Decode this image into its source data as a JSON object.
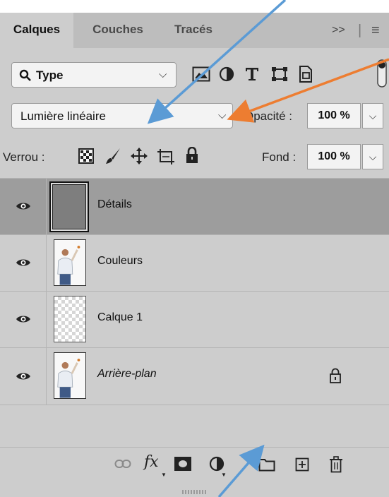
{
  "tabs": [
    {
      "label": "Calques",
      "active": true
    },
    {
      "label": "Couches",
      "active": false
    },
    {
      "label": "Tracés",
      "active": false
    }
  ],
  "tab_menu": {
    "collapse": ">>",
    "separator": "|",
    "menu": "≡"
  },
  "filter": {
    "label": "Type",
    "icons": [
      "image-filter-icon",
      "adjustment-filter-icon",
      "text-filter-icon",
      "shape-filter-icon",
      "smart-object-filter-icon",
      "filter-toggle-icon"
    ]
  },
  "blend": {
    "mode": "Lumière linéaire",
    "opacity_label": "Opacité :",
    "opacity_value": "100 %"
  },
  "lock": {
    "label": "Verrou :",
    "fill_label": "Fond :",
    "fill_value": "100 %",
    "icons": [
      "lock-transparent-pixels-icon",
      "lock-image-pixels-icon",
      "lock-position-icon",
      "lock-artboard-icon",
      "lock-all-icon"
    ]
  },
  "layers": [
    {
      "name": "Détails",
      "selected": true,
      "thumb": "gray",
      "italic": false,
      "locked": false
    },
    {
      "name": "Couleurs",
      "selected": false,
      "thumb": "photo",
      "italic": false,
      "locked": false
    },
    {
      "name": "Calque 1",
      "selected": false,
      "thumb": "transparent",
      "italic": false,
      "locked": false
    },
    {
      "name": "Arrière-plan",
      "selected": false,
      "thumb": "photo",
      "italic": true,
      "locked": true
    }
  ],
  "bottom_icons": [
    "link-layers-icon",
    "fx-icon",
    "add-mask-icon",
    "adjustment-layer-icon",
    "new-group-icon",
    "new-layer-icon",
    "delete-icon"
  ],
  "fx_label": "fx",
  "colors": {
    "panel": "#cdcdcd",
    "tabbar": "#bdbdbd",
    "selected_layer": "#9d9d9d",
    "arrow_blue": "#5b9bd5",
    "arrow_orange": "#ed7d31"
  }
}
